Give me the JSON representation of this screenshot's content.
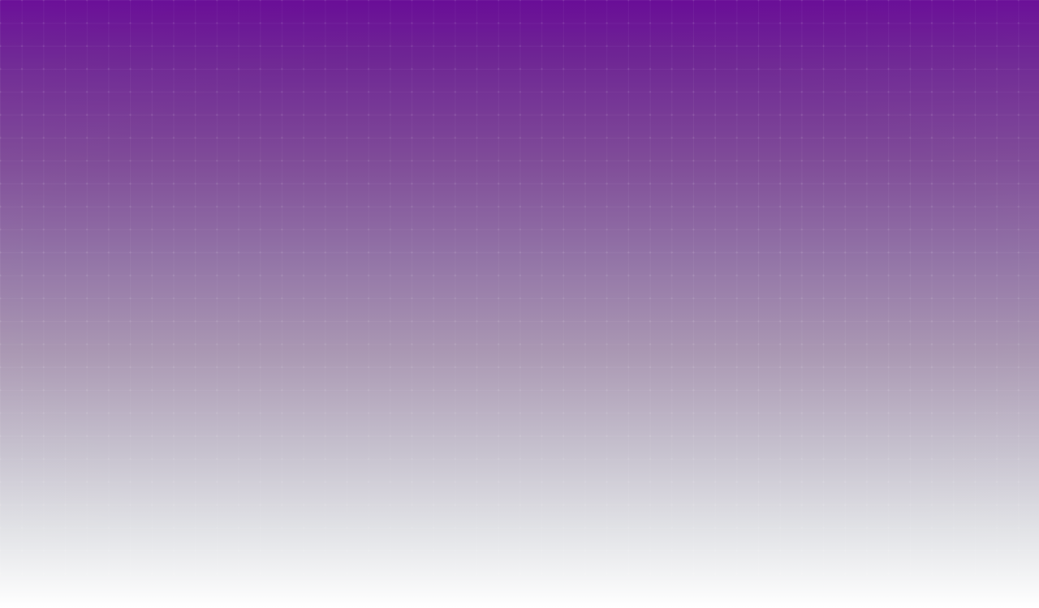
{
  "page": {
    "background": {
      "gradient_top": "#680b96",
      "gradient_mid": "#9273a6",
      "gradient_bottom": "#ffffff"
    }
  }
}
